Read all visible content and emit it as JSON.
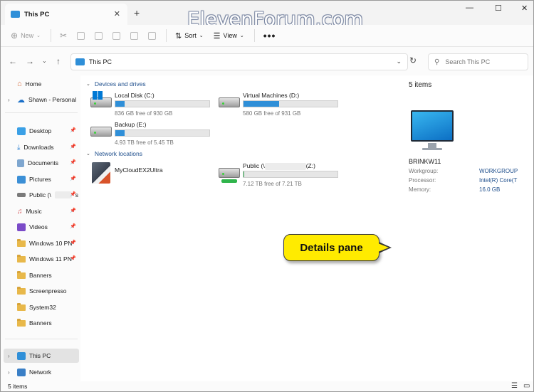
{
  "window": {
    "tab_title": "This PC",
    "tab_close": "✕",
    "tab_add": "+",
    "watermark": "ElevenForum.com",
    "controls": {
      "minimize": "—",
      "maximize": "☐",
      "close": "✕"
    }
  },
  "toolbar": {
    "new_label": "New",
    "sort_label": "Sort",
    "view_label": "View",
    "more_label": "•••"
  },
  "address": {
    "path": "This PC",
    "search_placeholder": "Search This PC"
  },
  "nav": {
    "items": [
      {
        "label": "Home"
      },
      {
        "label": "Shawn - Personal"
      },
      {
        "label": "Desktop"
      },
      {
        "label": "Downloads"
      },
      {
        "label": "Documents"
      },
      {
        "label": "Pictures"
      },
      {
        "label": "Public (\\",
        "suffix": "s"
      },
      {
        "label": "Music"
      },
      {
        "label": "Videos"
      },
      {
        "label": "Windows 10 PN"
      },
      {
        "label": "Windows 11 PN"
      },
      {
        "label": "Banners"
      },
      {
        "label": "Screenpresso"
      },
      {
        "label": "System32"
      },
      {
        "label": "Banners"
      },
      {
        "label": "This PC"
      },
      {
        "label": "Network"
      }
    ]
  },
  "content": {
    "devices_header": "Devices and drives",
    "network_header": "Network locations",
    "drives": [
      {
        "name": "Local Disk (C:)",
        "free": "836 GB free of 930 GB",
        "used_fraction": 0.1
      },
      {
        "name": "Virtual Machines (D:)",
        "free": "580 GB free of 931 GB",
        "used_fraction": 0.38
      },
      {
        "name": "Backup (E:)",
        "free": "4.93 TB free of 5.45 TB",
        "used_fraction": 0.1
      }
    ],
    "network": [
      {
        "name": "MyCloudEX2Ultra"
      },
      {
        "name_start": "Public (\\",
        "name_end": "(Z:)",
        "free": "7.12 TB free of 7.21 TB",
        "used_fraction": 0.01
      }
    ]
  },
  "details": {
    "count": "5 items",
    "pc_name": "BRINKW11",
    "props": [
      {
        "label": "Workgroup:",
        "value": "WORKGROUP"
      },
      {
        "label": "Processor:",
        "value": "Intel(R) Core(T"
      },
      {
        "label": "Memory:",
        "value": "16.0 GB"
      }
    ]
  },
  "callout": {
    "text": "Details pane"
  },
  "status": {
    "count": "5 items"
  },
  "colors": {
    "accent": "#2f8fd8",
    "callout": "#ffeb00",
    "link": "#1e4e8c"
  }
}
